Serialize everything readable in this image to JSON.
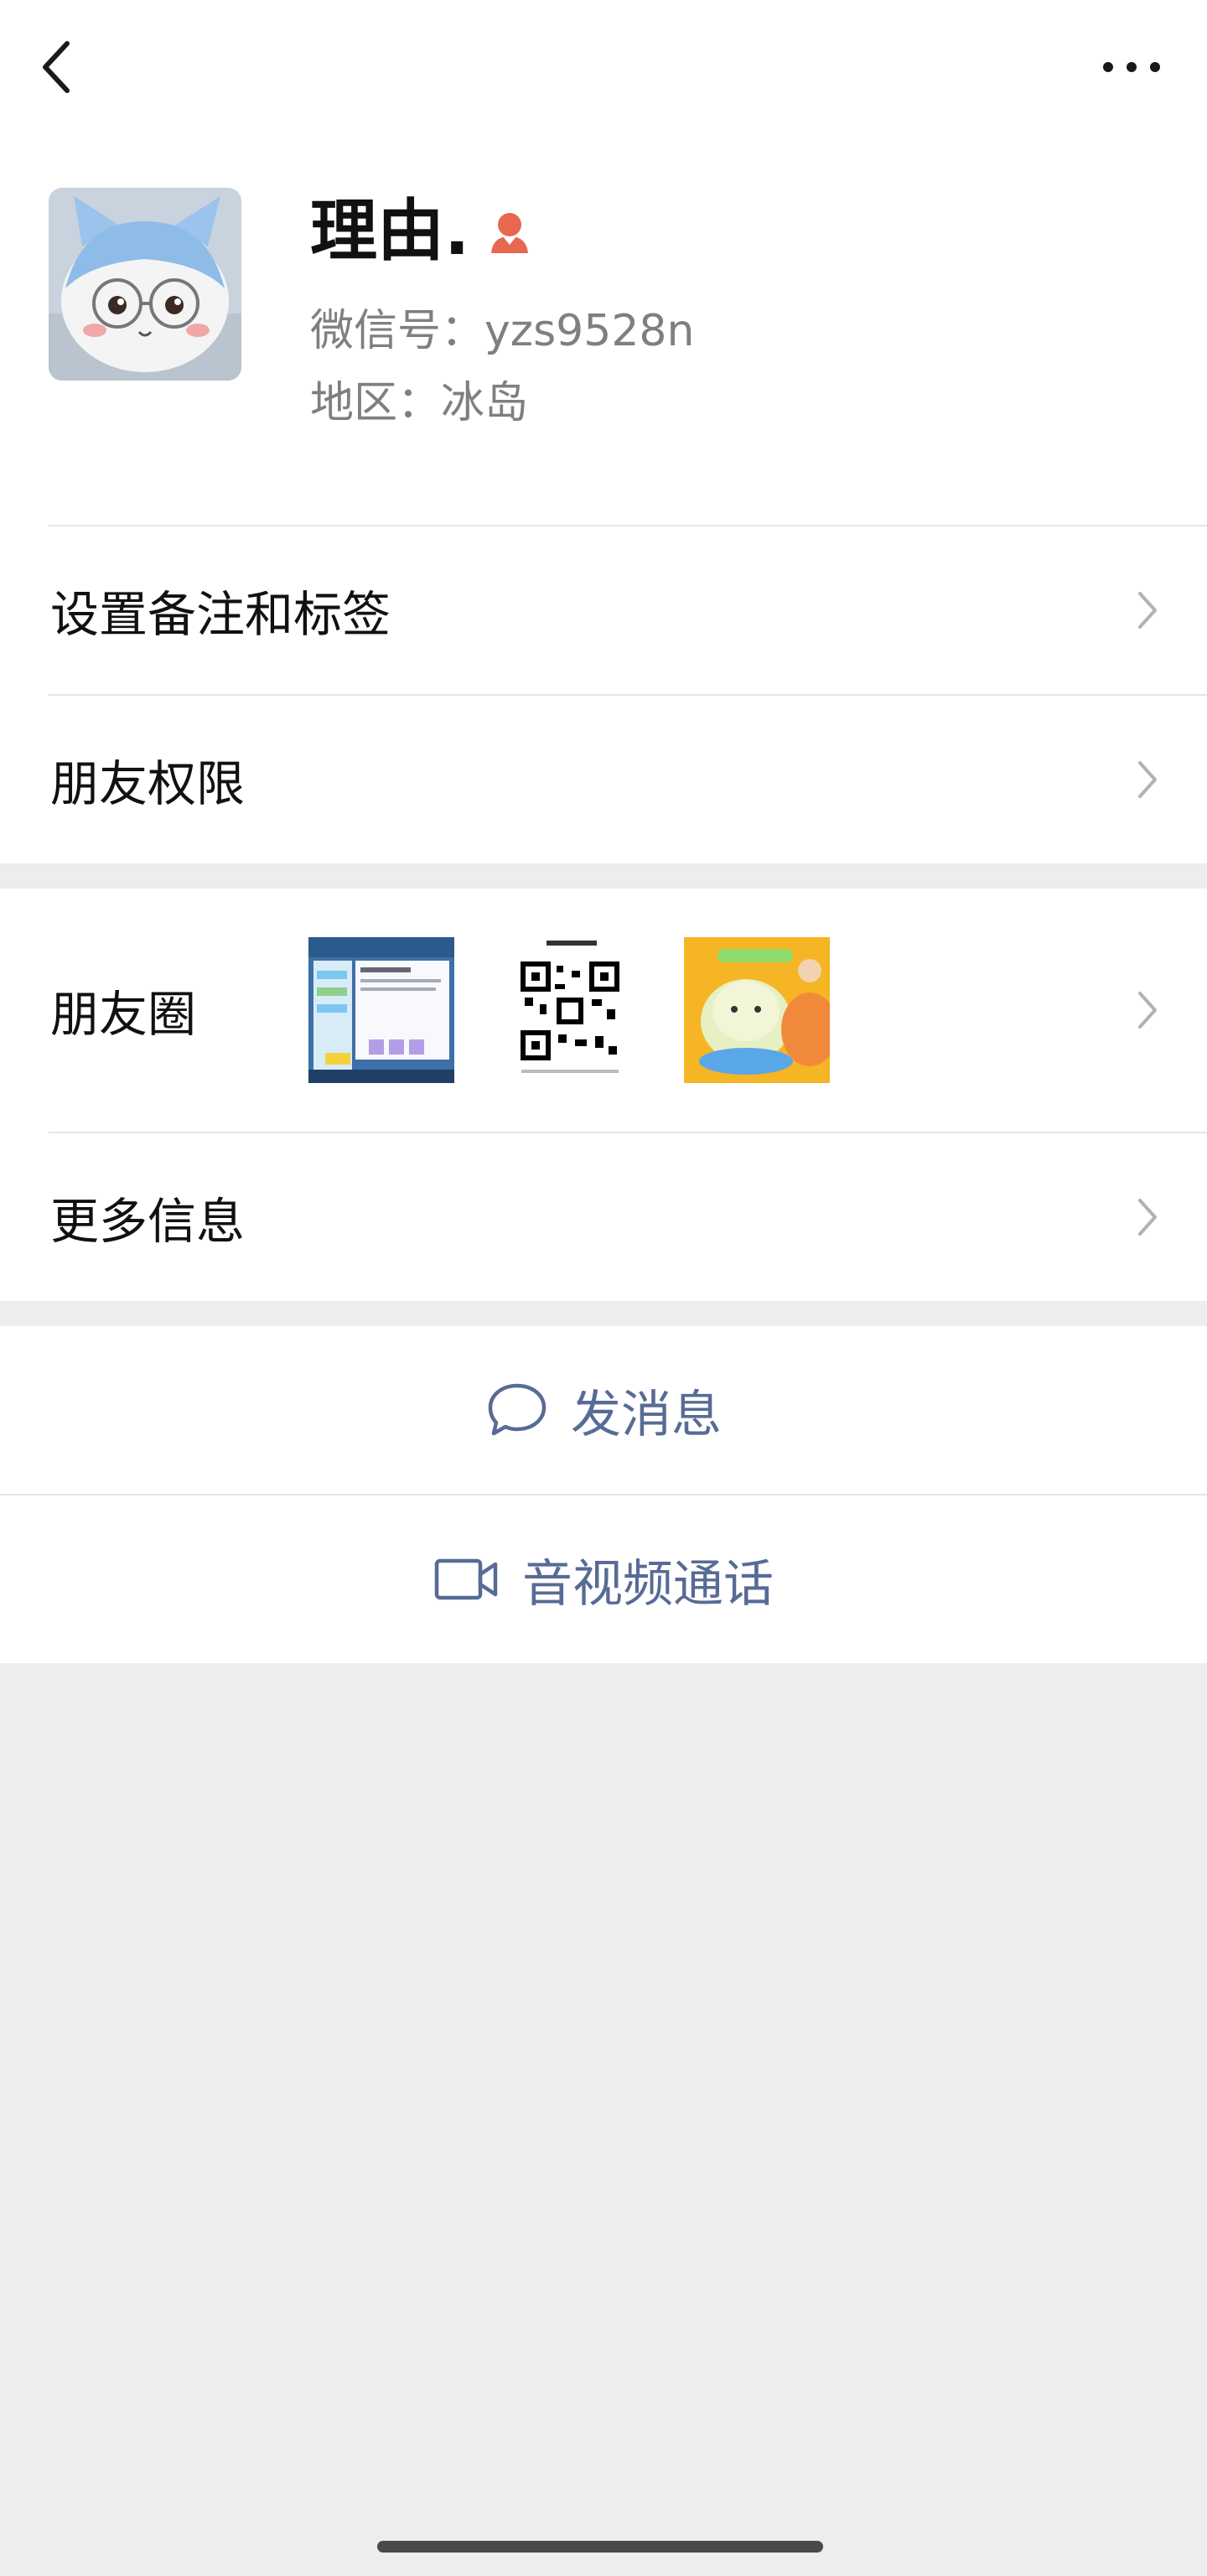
{
  "profile": {
    "name": "理由.",
    "wechat_id": "微信号：yzs9528n",
    "region": "地区：冰岛",
    "gender_icon": "female-icon",
    "avatar_desc": "avatar-icon"
  },
  "rows": {
    "remark": "设置备注和标签",
    "permission": "朋友权限",
    "moments": "朋友圈",
    "more": "更多信息"
  },
  "actions": {
    "message": "发消息",
    "call": "音视频通话"
  },
  "colors": {
    "link": "#576b95",
    "gender": "#e8674f",
    "background": "#ededed"
  },
  "icons": [
    "back-arrow-icon",
    "more-dots-icon",
    "chevron-right-icon",
    "chat-bubble-icon",
    "video-camera-icon"
  ]
}
